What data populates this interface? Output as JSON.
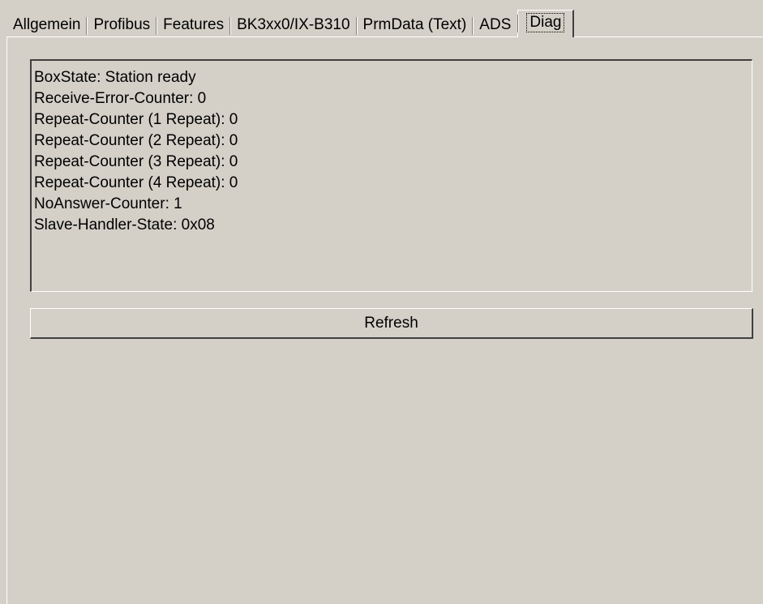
{
  "tabs": [
    {
      "label": "Allgemein",
      "active": false
    },
    {
      "label": "Profibus",
      "active": false
    },
    {
      "label": "Features",
      "active": false
    },
    {
      "label": "BK3xx0/IX-B310",
      "active": false
    },
    {
      "label": "PrmData (Text)",
      "active": false
    },
    {
      "label": "ADS",
      "active": false
    },
    {
      "label": "Diag",
      "active": true
    }
  ],
  "diag": {
    "lines": [
      "BoxState: Station ready",
      "Receive-Error-Counter: 0",
      "Repeat-Counter (1 Repeat): 0",
      "Repeat-Counter (2 Repeat): 0",
      "Repeat-Counter (3 Repeat): 0",
      "Repeat-Counter (4 Repeat): 0",
      "NoAnswer-Counter: 1",
      "Slave-Handler-State: 0x08"
    ]
  },
  "refresh_label": "Refresh"
}
